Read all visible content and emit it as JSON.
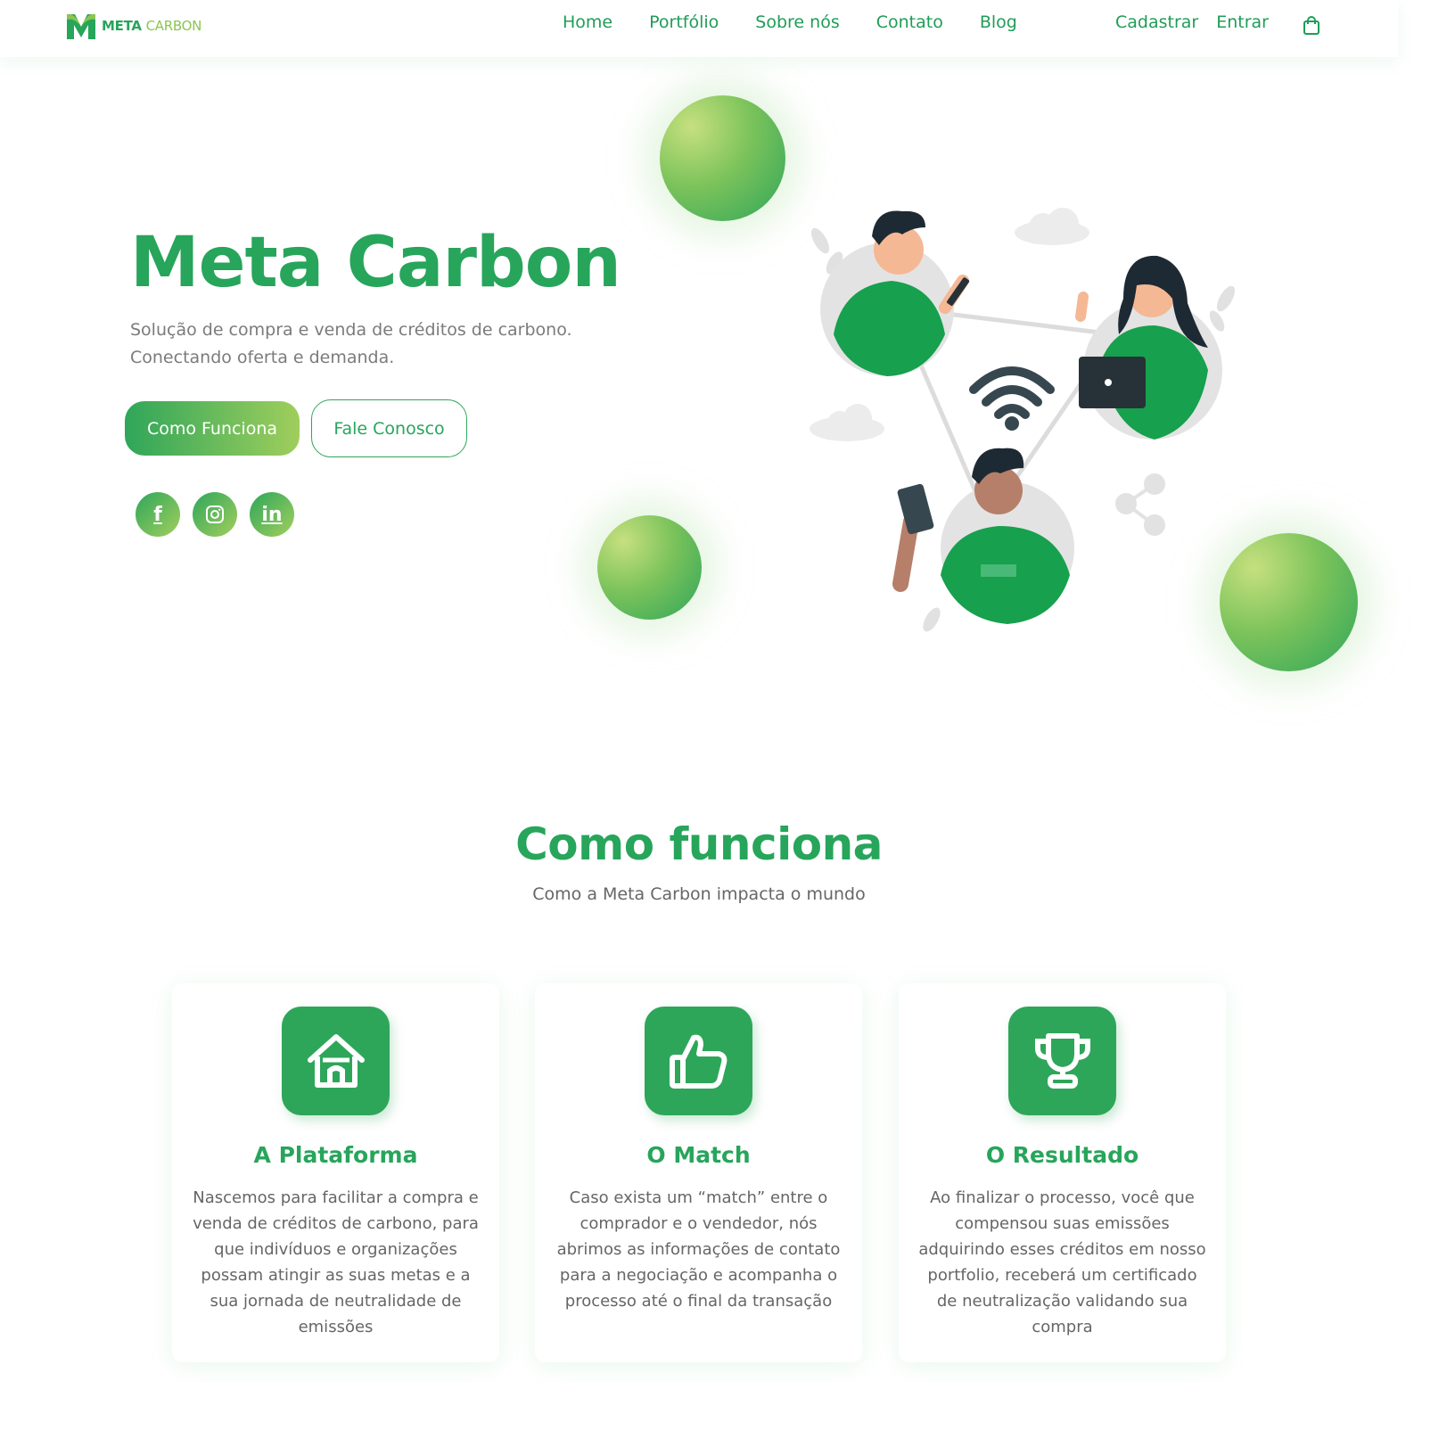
{
  "brand": {
    "name_part1": "META",
    "name_part2": "CARBON",
    "primary_color": "#27a55b",
    "accent_color": "#8cc54f"
  },
  "nav": {
    "items": [
      "Home",
      "Portfólio",
      "Sobre nós",
      "Contato",
      "Blog"
    ]
  },
  "auth": {
    "register": "Cadastrar",
    "login": "Entrar",
    "cart_icon": "shopping-bag-icon"
  },
  "hero": {
    "title": "Meta Carbon",
    "subtitle_line1": "Solução de compra e venda de créditos de carbono.",
    "subtitle_line2": "Conectando oferta e demanda.",
    "primary_button": "Como Funciona",
    "secondary_button": "Fale Conosco",
    "social": [
      {
        "icon": "facebook-icon",
        "glyph": "f"
      },
      {
        "icon": "instagram-icon",
        "glyph": ""
      },
      {
        "icon": "linkedin-icon",
        "glyph": "in"
      }
    ]
  },
  "how_it_works": {
    "title": "Como funciona",
    "subtitle": "Como a Meta Carbon impacta o mundo",
    "cards": [
      {
        "icon": "house-icon",
        "title": "A Plataforma",
        "text": "Nascemos para facilitar a compra e venda de créditos de carbono, para que indivíduos e organizações possam atingir as suas metas e a sua jornada de neutralidade de emissões"
      },
      {
        "icon": "thumbs-up-icon",
        "title": "O Match",
        "text": "Caso exista um “match” entre o comprador e o vendedor, nós abrimos as informações de contato para a negociação e acompanha o processo até o final da transação"
      },
      {
        "icon": "trophy-icon",
        "title": "O Resultado",
        "text": "Ao finalizar o processo, você que compensou suas emissões adquirindo esses créditos em nosso portfolio, receberá um certificado de neutralização validando sua compra"
      }
    ]
  }
}
